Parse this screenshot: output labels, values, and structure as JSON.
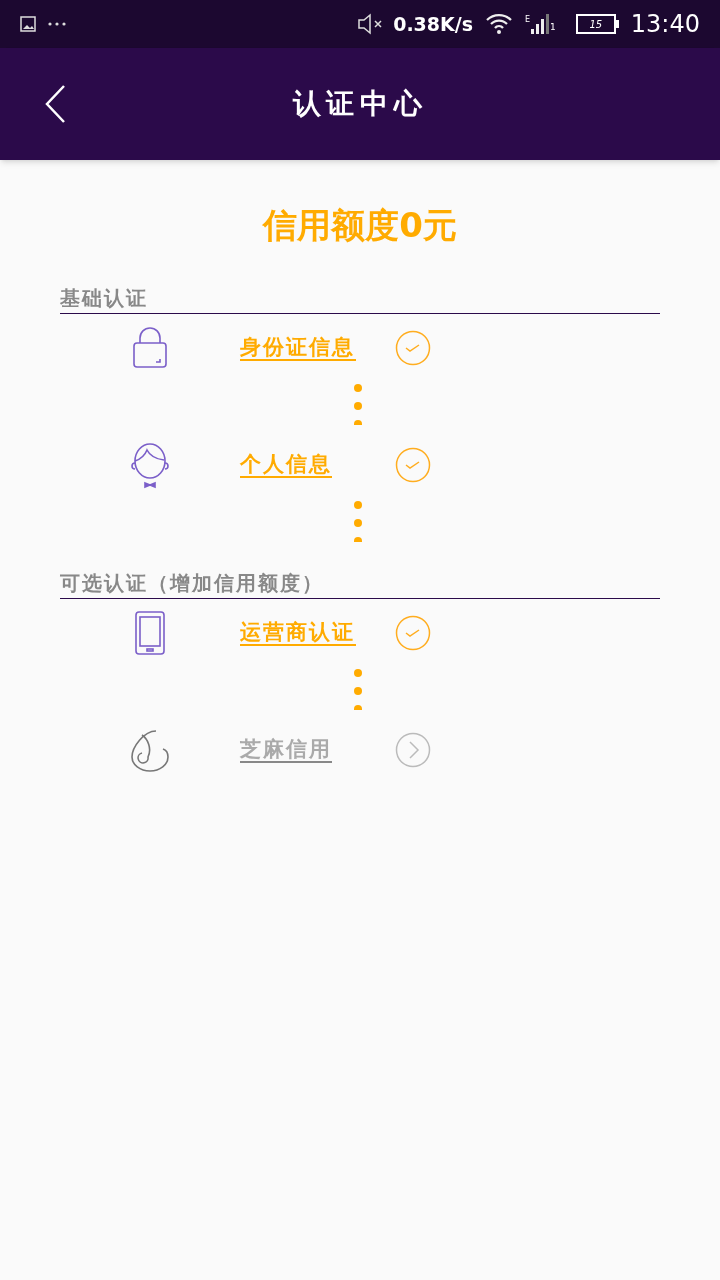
{
  "status_bar": {
    "speed": "0.38K/s",
    "sim": "1",
    "network": "E",
    "battery": "15",
    "time": "13:40"
  },
  "header": {
    "title": "认证中心"
  },
  "credit": {
    "text": "信用额度0元"
  },
  "sections": [
    {
      "title": "基础认证",
      "items": [
        {
          "kind": "id",
          "label": "身份证信息",
          "done": true,
          "connector_after": true
        },
        {
          "kind": "person",
          "label": "个人信息",
          "done": true,
          "connector_after": true
        }
      ]
    },
    {
      "title": "可选认证（增加信用额度）",
      "items": [
        {
          "kind": "phone",
          "label": "运营商认证",
          "done": true,
          "connector_after": true
        },
        {
          "kind": "sesame",
          "label": "芝麻信用",
          "done": false,
          "connector_after": false
        }
      ]
    }
  ]
}
